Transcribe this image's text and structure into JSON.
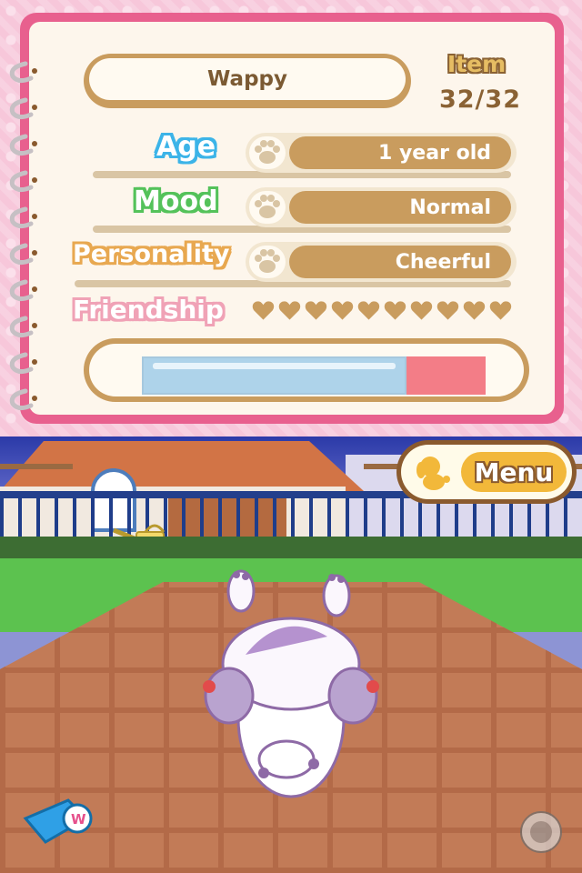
{
  "pet": {
    "name": "Wappy",
    "item_label": "Item",
    "item_count": "32/32"
  },
  "stats": {
    "age_label": "Age",
    "age_value": "1 year old",
    "mood_label": "Mood",
    "mood_value": "Normal",
    "personality_label": "Personality",
    "personality_value": "Cheerful",
    "friendship_label": "Friendship",
    "friendship_hearts": 10
  },
  "gauge": {
    "fill_fraction": 0.77
  },
  "menu": {
    "label": "Menu"
  },
  "icons": {
    "paw": "paw-icon",
    "heart": "heart-icon",
    "whistle": "whistle-icon",
    "dog": "dog-icon"
  },
  "colors": {
    "notebook_pink": "#e8608e",
    "tan": "#c99c5e",
    "age_blue": "#3cb4e8",
    "mood_green": "#54c25a",
    "personality_orange": "#e8a850",
    "friendship_pink": "#f0a2b6",
    "heart_brown": "#c99c5e",
    "gauge_blue": "#aed3ea",
    "gauge_red": "#f37d87"
  }
}
